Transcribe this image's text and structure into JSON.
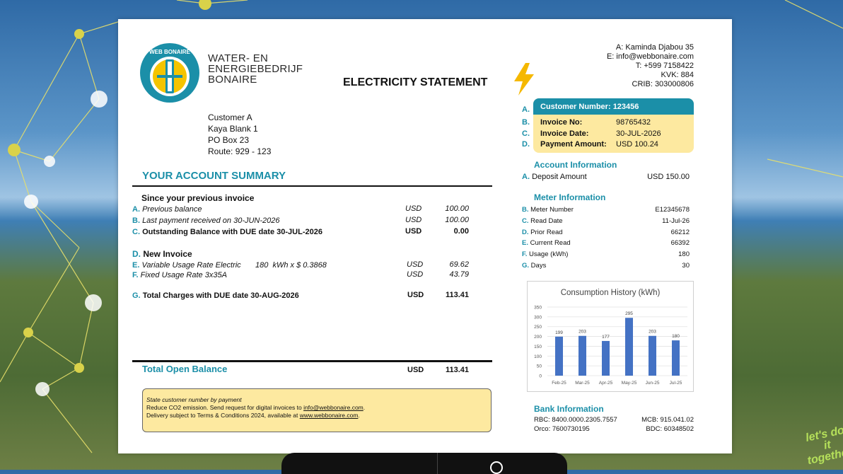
{
  "company": {
    "logo_ring_text": "WEB BONAIRE",
    "name_line1": "WATER- EN",
    "name_line2": "ENERGIEBEDRIJF",
    "name_line3": "BONAIRE"
  },
  "document_title": "ELECTRICITY STATEMENT",
  "contact": {
    "address": "A: Kaminda Djabou 35",
    "email": "E: info@webbonaire.com",
    "phone": "T: +599 7158422",
    "kvk": "KVK: 884",
    "crib": "CRIB: 303000806"
  },
  "customer_address": [
    "Customer A",
    "Kaya Blank 1",
    "PO Box 23",
    "Route: 929 - 123"
  ],
  "summary": {
    "title": "YOUR ACCOUNT SUMMARY",
    "since_label": "Since your previous invoice",
    "previous_balance": {
      "letter": "A.",
      "label": "Previous balance",
      "currency": "USD",
      "amount": "100.00"
    },
    "last_payment": {
      "letter": "B.",
      "label": "Last payment received on 30-JUN-2026",
      "currency": "USD",
      "amount": "100.00"
    },
    "outstanding": {
      "letter": "C.",
      "label": "Outstanding Balance with DUE date 30-JUL-2026",
      "currency": "USD",
      "amount": "0.00"
    },
    "new_invoice": {
      "letter": "D.",
      "label": "New Invoice"
    },
    "variable": {
      "letter": "E.",
      "label": "Variable Usage Rate Electric",
      "detail": "180  kWh x $ 0.3868",
      "currency": "USD",
      "amount": "69.62"
    },
    "fixed": {
      "letter": "F.",
      "label": "Fixed Usage Rate 3x35A",
      "currency": "USD",
      "amount": "43.79"
    },
    "total_charges": {
      "letter": "G.",
      "label": "Total Charges with DUE date 30-AUG-2026",
      "currency": "USD",
      "amount": "113.41"
    },
    "total_open": {
      "label": "Total Open Balance",
      "currency": "USD",
      "amount": "113.41"
    }
  },
  "note": {
    "line1": "State customer number by payment",
    "line2_pre": "Reduce CO2 emission. Send request for digital invoices to ",
    "line2_link": "info@webbonaire.com",
    "line2_post": ".",
    "line3_pre": "Delivery subject to Terms & Conditions 2024, available at ",
    "line3_link": "www.webbonaire.com",
    "line3_post": "."
  },
  "invoice_box": {
    "customer_number_label": "Customer Number:",
    "customer_number": "123456",
    "invoice_no_label": "Invoice No:",
    "invoice_no": "98765432",
    "invoice_date_label": "Invoice Date:",
    "invoice_date": "30-JUL-2026",
    "payment_amount_label": "Payment Amount:",
    "payment_amount": "USD 100.24",
    "letters": [
      "A.",
      "B.",
      "C.",
      "D."
    ]
  },
  "account_info": {
    "title": "Account Information",
    "deposit": {
      "letter": "A.",
      "label": "Deposit Amount",
      "value": "USD 150.00"
    }
  },
  "meter_info": {
    "title": "Meter Information",
    "rows": [
      {
        "letter": "B.",
        "label": "Meter Number",
        "value": "E12345678"
      },
      {
        "letter": "C.",
        "label": "Read Date",
        "value": "11-Jul-26"
      },
      {
        "letter": "D.",
        "label": "Prior Read",
        "value": "66212"
      },
      {
        "letter": "E.",
        "label": "Current Read",
        "value": "66392"
      },
      {
        "letter": "F.",
        "label": "Usage (kWh)",
        "value": "180"
      },
      {
        "letter": "G.",
        "label": "Days",
        "value": "30"
      }
    ]
  },
  "chart_data": {
    "type": "bar",
    "title": "Consumption History (kWh)",
    "categories": [
      "Feb-25",
      "Mar-25",
      "Apr-25",
      "May-25",
      "Jun-25",
      "Jul-25"
    ],
    "values": [
      199,
      203,
      177,
      295,
      203,
      180
    ],
    "ylim": [
      0,
      350
    ],
    "yticks": [
      0,
      50,
      100,
      150,
      200,
      250,
      300,
      350
    ],
    "grid": true,
    "bar_color": "#4472c4"
  },
  "bank": {
    "title": "Bank Information",
    "rbc": "RBC: 8400.0000.2305.7557",
    "mcb": "MCB: 915.041.02",
    "orco": "Orco: 7600730195",
    "bdc": "BDC: 60348502"
  },
  "slogan": {
    "line1": "let's do it",
    "line2": "together"
  },
  "colors": {
    "teal": "#1b8fa8",
    "yellow_box": "#fde9a0",
    "logo_yellow": "#f5c400",
    "bar": "#4472c4"
  }
}
